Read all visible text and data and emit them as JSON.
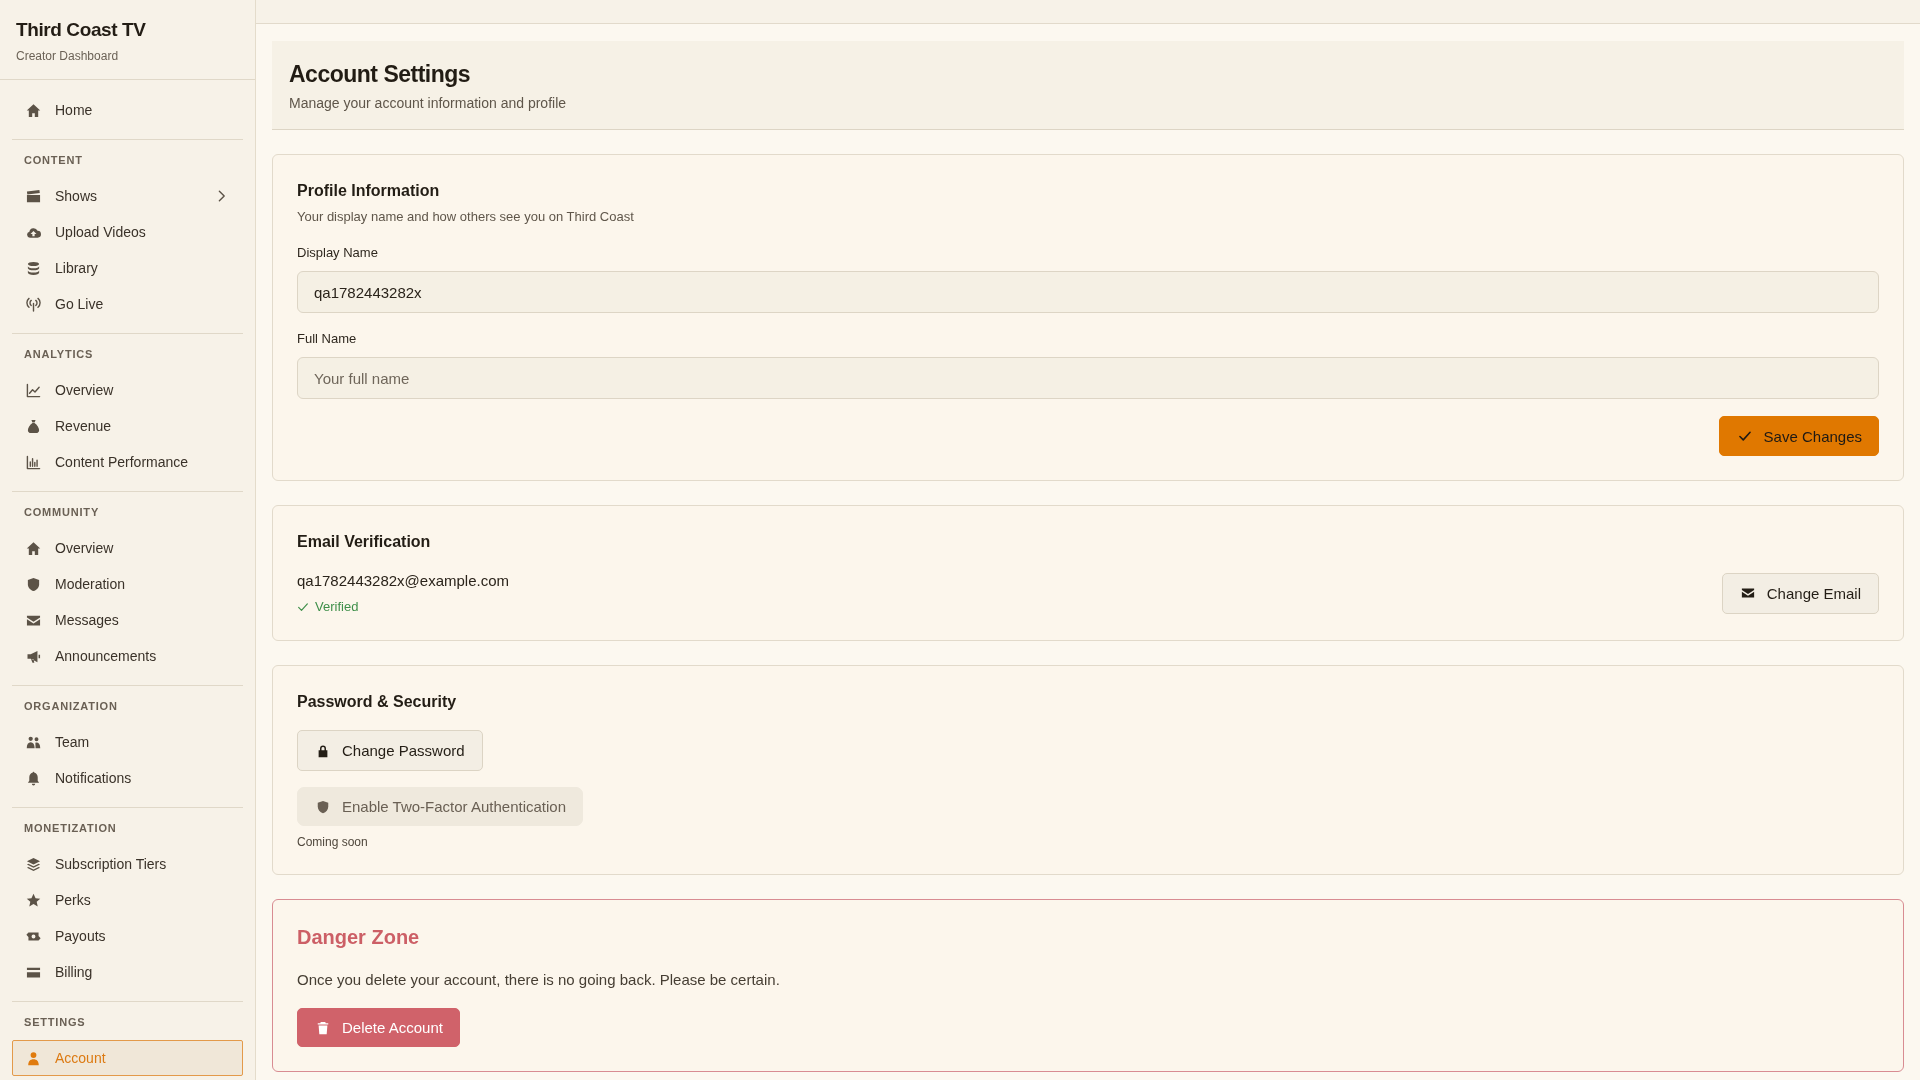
{
  "sidebar": {
    "brand": {
      "title": "Third Coast TV",
      "subtitle": "Creator Dashboard"
    },
    "sections": [
      {
        "items": [
          {
            "label": "Home",
            "selected": false
          }
        ]
      },
      {
        "heading": "CONTENT",
        "items": [
          {
            "label": "Shows",
            "selected": false,
            "expanded": false
          },
          {
            "label": "Upload Videos",
            "selected": false
          },
          {
            "label": "Library",
            "selected": false
          },
          {
            "label": "Go Live",
            "selected": false
          }
        ]
      },
      {
        "heading": "ANALYTICS",
        "items": [
          {
            "label": "Overview",
            "selected": false
          },
          {
            "label": "Revenue",
            "selected": false
          },
          {
            "label": "Content Performance",
            "selected": false
          }
        ]
      },
      {
        "heading": "COMMUNITY",
        "items": [
          {
            "label": "Overview",
            "selected": false
          },
          {
            "label": "Moderation",
            "selected": false
          },
          {
            "label": "Messages",
            "selected": false
          },
          {
            "label": "Announcements",
            "selected": false
          }
        ]
      },
      {
        "heading": "ORGANIZATION",
        "items": [
          {
            "label": "Team",
            "selected": false
          },
          {
            "label": "Notifications",
            "selected": false
          }
        ]
      },
      {
        "heading": "MONETIZATION",
        "items": [
          {
            "label": "Subscription Tiers",
            "selected": false
          },
          {
            "label": "Perks",
            "selected": false
          },
          {
            "label": "Payouts",
            "selected": false
          },
          {
            "label": "Billing",
            "selected": false
          }
        ]
      },
      {
        "heading": "SETTINGS",
        "items": [
          {
            "label": "Account",
            "selected": true
          }
        ]
      }
    ]
  },
  "page_header": {
    "title": "Account Settings",
    "subtitle": "Manage your account information and profile"
  },
  "cards": [
    {
      "kind": "profile",
      "title": "Profile Information",
      "subtitle": "Your display name and how others see you on Third Coast",
      "fields": [
        {
          "label": "Display Name",
          "value": "qa1782443282x"
        },
        {
          "label": "Full Name",
          "placeholder": "Your full name"
        }
      ],
      "button": "Save Changes"
    },
    {
      "kind": "email",
      "title": "Email Verification",
      "email": "qa1782443282x@example.com",
      "verified": true,
      "status": "Verified",
      "button": "Change Email"
    },
    {
      "kind": "security",
      "title": "Password & Security",
      "buttons": [
        {
          "label": "Change Password",
          "disabled": false
        },
        {
          "label": "Enable Two-Factor Authentication",
          "disabled": true
        }
      ],
      "note": "Coming soon"
    },
    {
      "kind": "danger",
      "title": "Danger Zone",
      "text": "Once you delete your account, there is no going back. Please be certain.",
      "button": "Delete Account"
    }
  ]
}
